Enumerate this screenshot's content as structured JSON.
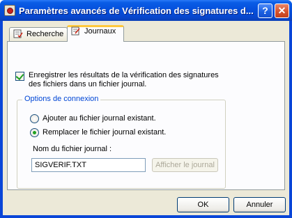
{
  "window": {
    "title": "Paramètres avancés de Vérification des signatures d...",
    "help_label": "?",
    "close_label": "✕"
  },
  "tabs": [
    {
      "label": "Recherche",
      "selected": false
    },
    {
      "label": "Journaux",
      "selected": true
    }
  ],
  "log": {
    "checkbox_label": "Enregistrer les résultats de la vérification des signatures des fichiers dans un fichier journal.",
    "checkbox_checked": true
  },
  "options": {
    "group_title": "Options de connexion",
    "radio_append_label": "Ajouter au fichier journal existant.",
    "radio_replace_label": "Remplacer le fichier journal existant.",
    "selected": "replace",
    "filename_label": "Nom du fichier journal :",
    "filename_value": "SIGVERIF.TXT",
    "view_log_label": "Afficher le journal"
  },
  "footer": {
    "ok_label": "OK",
    "cancel_label": "Annuler"
  },
  "colors": {
    "titlebar": "#0550dc",
    "group_title": "#0046d5",
    "check_green": "#21a121",
    "tab_highlight": "#ffc83c"
  }
}
